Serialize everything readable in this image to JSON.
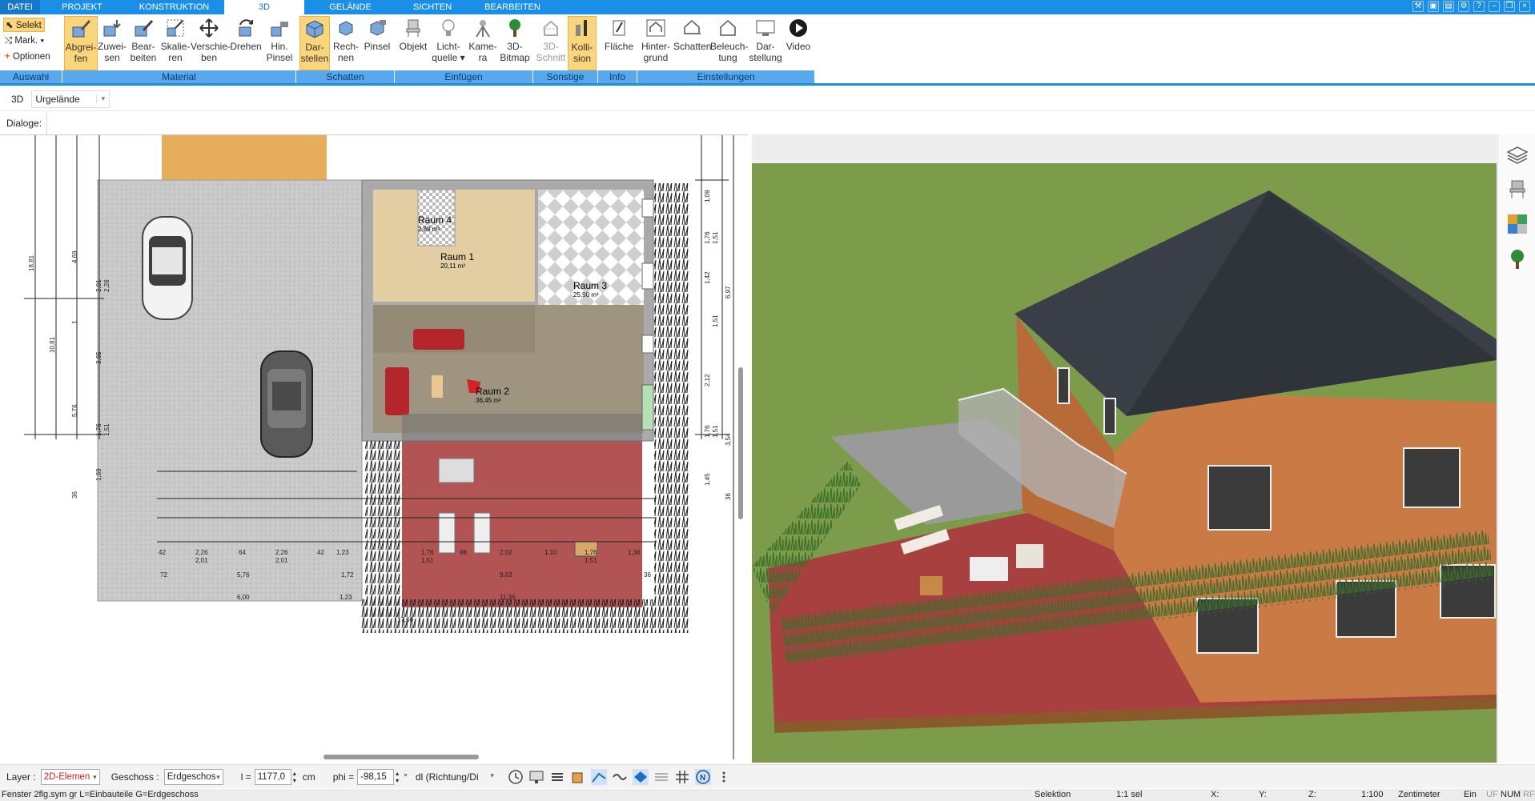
{
  "menu": {
    "tabs": [
      {
        "label": "DATEI"
      },
      {
        "label": "PROJEKT"
      },
      {
        "label": "KONSTRUKTION"
      },
      {
        "label": "3D"
      },
      {
        "label": "GELÄNDE"
      },
      {
        "label": "SICHTEN"
      },
      {
        "label": "BEARBEITEN"
      }
    ],
    "active": "3D"
  },
  "ribbon": {
    "auswahl": {
      "selekt": "Selekt",
      "mark": "Mark.",
      "optionen": "Optionen"
    },
    "buttons": [
      {
        "l1": "Abgrei-",
        "l2": "fen"
      },
      {
        "l1": "Zuwei-",
        "l2": "sen"
      },
      {
        "l1": "Bear-",
        "l2": "beiten"
      },
      {
        "l1": "Skalie-",
        "l2": "ren"
      },
      {
        "l1": "Verschie-",
        "l2": "ben"
      },
      {
        "l1": "Drehen",
        "l2": ""
      },
      {
        "l1": "Hin.",
        "l2": "Pinsel"
      },
      {
        "l1": "Dar-",
        "l2": "stellen"
      },
      {
        "l1": "Rech-",
        "l2": "nen"
      },
      {
        "l1": "Pinsel",
        "l2": ""
      },
      {
        "l1": "Objekt",
        "l2": ""
      },
      {
        "l1": "Licht-",
        "l2": "quelle"
      },
      {
        "l1": "Kame-",
        "l2": "ra"
      },
      {
        "l1": "3D-",
        "l2": "Bitmap"
      },
      {
        "l1": "3D-",
        "l2": "Schnitt"
      },
      {
        "l1": "Kolli-",
        "l2": "sion"
      },
      {
        "l1": "Fläche",
        "l2": ""
      },
      {
        "l1": "Hinter-",
        "l2": "grund"
      },
      {
        "l1": "Schatten",
        "l2": ""
      },
      {
        "l1": "Beleuch-",
        "l2": "tung"
      },
      {
        "l1": "Dar-",
        "l2": "stellung"
      },
      {
        "l1": "Video",
        "l2": ""
      }
    ],
    "groups": [
      {
        "label": "Auswahl"
      },
      {
        "label": "Material"
      },
      {
        "label": "Schatten"
      },
      {
        "label": "Einfügen"
      },
      {
        "label": "Sonstige"
      },
      {
        "label": "Info"
      },
      {
        "label": "Einstellungen"
      }
    ]
  },
  "viewrow": {
    "mode": "3D",
    "terrain": "Urgelände"
  },
  "dialogs": {
    "label": "Dialoge:"
  },
  "plan": {
    "rooms": [
      {
        "name": "Raum 4",
        "area": "2,89 m²"
      },
      {
        "name": "Raum 1",
        "area": "20,11 m²"
      },
      {
        "name": "Raum 3",
        "area": "25,90 m²"
      },
      {
        "name": "Raum 2",
        "area": "36,45 m²"
      }
    ],
    "dims_left": [
      "18,81",
      "10,81",
      "4,69",
      "2,01",
      "2,26",
      "1",
      "3,65",
      "5,76",
      "1,76",
      "1,51",
      "1,69",
      "36"
    ],
    "dims_right": [
      "1,09",
      "1,76",
      "1,51",
      "1,42",
      "6,97",
      "1,51",
      "2,12",
      "1,76",
      "1,51",
      "3,54",
      "1,45",
      "36"
    ],
    "dims_bottom_row1": [
      "42",
      "2,26",
      "64",
      "2,26",
      "42",
      "1,23",
      "1,76",
      "98",
      "2,02",
      "1,10",
      "1,76",
      "1,36"
    ],
    "dims_bottom_row2": [
      "2,01",
      "2,01",
      "1,51",
      "1,51"
    ],
    "dims_bottom_row3": [
      "72",
      "5,76",
      "1,72",
      "9,63",
      "36"
    ],
    "dims_bottom_row4": [
      "6,00",
      "1,23",
      "11,36"
    ],
    "dims_bottom_row5": [
      "17,60"
    ]
  },
  "optbar": {
    "layer_label": "Layer :",
    "layer_value": "2D-Elemen",
    "geschoss_label": "Geschoss :",
    "geschoss_value": "Erdgeschos",
    "l_label": "l =",
    "l_value": "1177,0",
    "l_unit": "cm",
    "phi_label": "phi =",
    "phi_value": "-98,15",
    "phi_unit": "°",
    "dl_value": "dl (Richtung/Di"
  },
  "status": {
    "left": "Fenster 2flg.sym gr L=Einbauteile G=Erdgeschoss",
    "selektion": "Selektion",
    "sel_count": "1:1 sel",
    "x": "X:",
    "y": "Y:",
    "z": "Z:",
    "scale": "1:100",
    "unit": "Zentimeter",
    "ein": "Ein",
    "uf": "UF",
    "num": "NUM",
    "rf": "RF"
  },
  "colors": {
    "menubar": "#1b8fe8",
    "group_strip": "#5aa8ec",
    "highlight": "#fbd57c",
    "roof": "#3a3f47",
    "facade": "#c97a45",
    "terrace": "#a83c3c",
    "lawn": "#7c9c4c",
    "layer_text": "#d02020"
  }
}
